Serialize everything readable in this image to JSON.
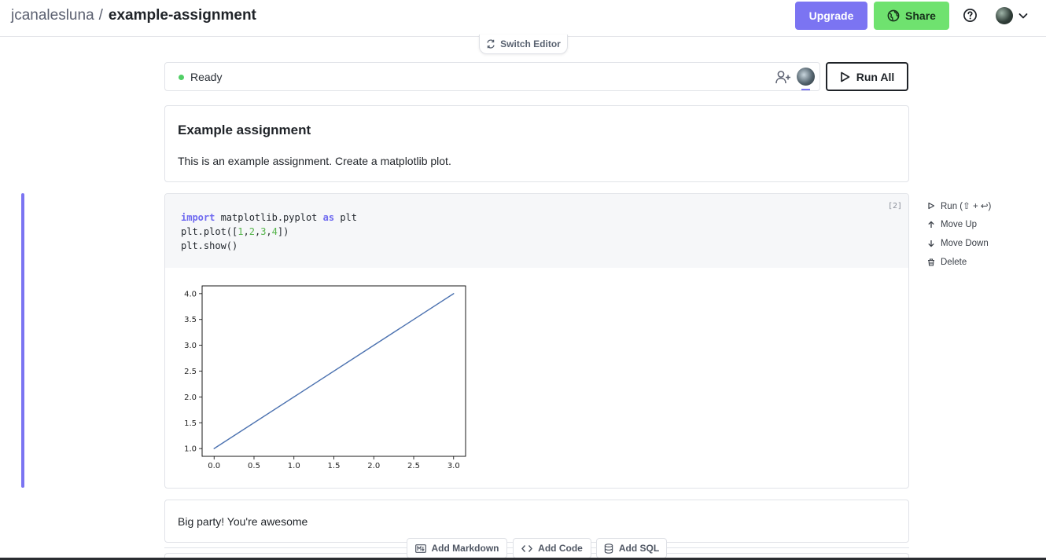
{
  "header": {
    "owner": "jcanalesluna",
    "separator": "/",
    "project": "example-assignment",
    "upgrade_label": "Upgrade",
    "share_label": "Share",
    "icons": [
      "help-icon",
      "avatar",
      "chevron-down-icon",
      "globe-icon"
    ]
  },
  "switch_editor": {
    "label": "Switch Editor"
  },
  "status": {
    "label": "Ready",
    "run_all_label": "Run All"
  },
  "cells": {
    "markdown_1": {
      "title": "Example assignment",
      "body": "This is an example assignment. Create a matplotlib plot."
    },
    "code": {
      "execution_count": "[2]",
      "lines": [
        {
          "kw": "import",
          "a": " matplotlib.pyplot ",
          "kw2": "as",
          "b": " plt"
        },
        {
          "a": "plt.plot([",
          "n1": "1",
          "c1": ",",
          "n2": "2",
          "c2": ",",
          "n3": "3",
          "c3": ",",
          "n4": "4",
          "b": "])"
        },
        {
          "a": "plt.show()"
        }
      ]
    },
    "markdown_2": {
      "body": "Big party! You're awesome"
    }
  },
  "side_actions": {
    "run": "Run (⇧ + ↩)",
    "move_up": "Move Up",
    "move_down": "Move Down",
    "delete": "Delete"
  },
  "add_bar": {
    "markdown": "Add Markdown",
    "code": "Add Code",
    "sql": "Add SQL"
  },
  "colors": {
    "accent": "#7b74f2",
    "share_green": "#6fe26f",
    "status_green": "#51cf66",
    "line": "#4c72b0"
  },
  "chart_data": {
    "type": "line",
    "x": [
      0,
      1,
      2,
      3
    ],
    "series": [
      {
        "values": [
          1,
          2,
          3,
          4
        ]
      }
    ],
    "xticks": [
      "0.0",
      "0.5",
      "1.0",
      "1.5",
      "2.0",
      "2.5",
      "3.0"
    ],
    "yticks": [
      "1.0",
      "1.5",
      "2.0",
      "2.5",
      "3.0",
      "3.5",
      "4.0"
    ],
    "xlim": [
      -0.15,
      3.15
    ],
    "ylim": [
      0.85,
      4.15
    ],
    "title": "",
    "xlabel": "",
    "ylabel": "",
    "grid": false
  }
}
